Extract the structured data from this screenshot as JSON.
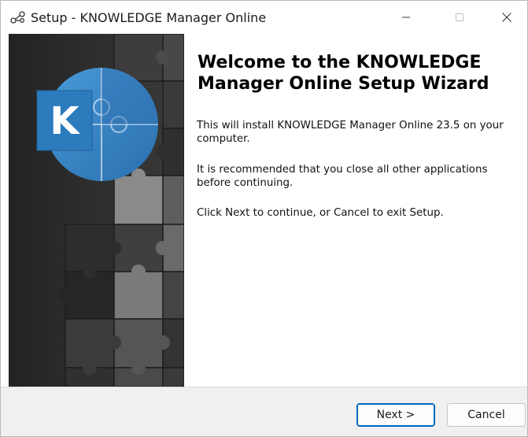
{
  "window": {
    "title": "Setup - KNOWLEDGE Manager Online",
    "app_icon": "link-nodes-icon"
  },
  "controls": {
    "minimize_icon": "minimize-icon",
    "maximize_icon": "maximize-icon",
    "close_icon": "close-icon"
  },
  "sidebar": {
    "logo_letter": "K",
    "logo_icon": "knowledge-manager-logo",
    "background": "puzzle-pieces-pattern",
    "logo_colors": {
      "blue": "#3b8ed0",
      "dark_blue": "#2f6fb0",
      "tile": "#2c7bbd"
    }
  },
  "content": {
    "heading": "Welcome to the KNOWLEDGE Manager Online Setup Wizard",
    "paragraph1": "This will install KNOWLEDGE Manager Online 23.5 on your computer.",
    "paragraph2": "It is recommended that you close all other applications before continuing.",
    "paragraph3": "Click Next to continue, or Cancel to exit Setup."
  },
  "footer": {
    "next_label": "Next >",
    "cancel_label": "Cancel"
  },
  "colors": {
    "accent": "#0067c0",
    "footer_bg": "#f0f0f0",
    "sidebar_bg": "#2b2b2b"
  }
}
